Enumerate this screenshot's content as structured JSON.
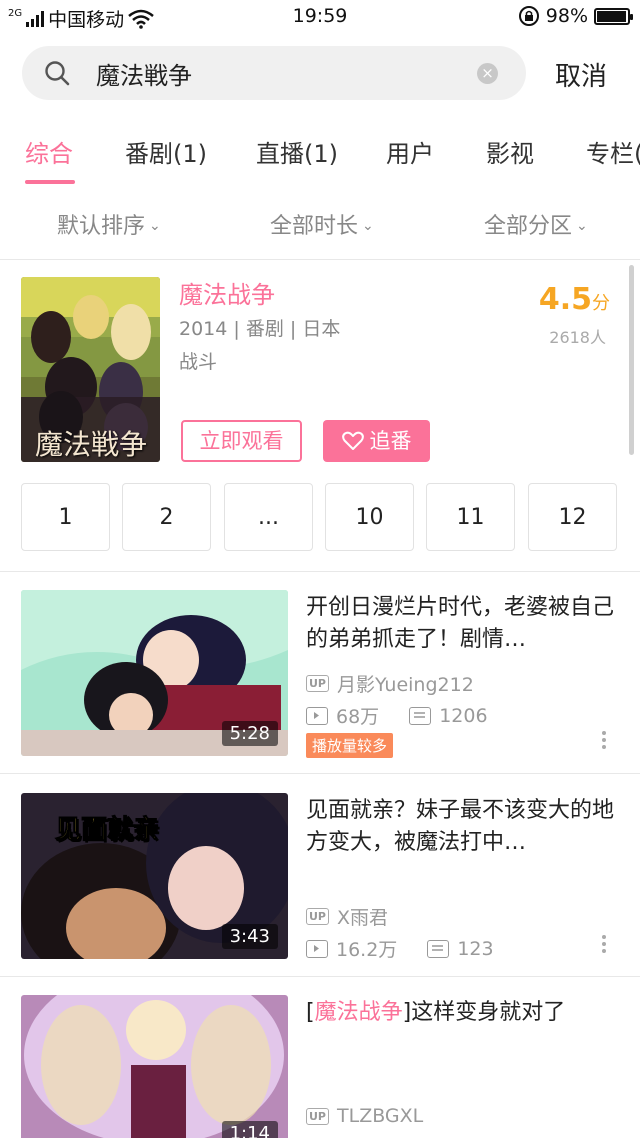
{
  "status_bar": {
    "carrier": "中国移动",
    "network": "2G",
    "time": "19:59",
    "battery": "98%",
    "battery_level": 0.98
  },
  "search": {
    "query": "魔法戦争",
    "cancel_label": "取消"
  },
  "tabs": [
    {
      "label": "综合",
      "active": true
    },
    {
      "label": "番剧(1)"
    },
    {
      "label": "直播(1)"
    },
    {
      "label": "用户"
    },
    {
      "label": "影视"
    },
    {
      "label": "专栏("
    }
  ],
  "filters": [
    {
      "label": "默认排序"
    },
    {
      "label": "全部时长"
    },
    {
      "label": "全部分区"
    }
  ],
  "anime": {
    "cover_text": "魔法戦争",
    "title": "魔法战争",
    "meta": "2014 | 番剧 | 日本",
    "genre": "战斗",
    "score": "4.5",
    "score_unit": "分",
    "votes": "2618人",
    "watch_label": "立即观看",
    "follow_label": "追番",
    "episodes": [
      "1",
      "2",
      "...",
      "10",
      "11",
      "12"
    ]
  },
  "videos": [
    {
      "title": "开创日漫烂片时代，老婆被自己的弟弟抓走了！剧情…",
      "uploader": "月影Yueing212",
      "views": "68万",
      "danmaku": "1206",
      "duration": "5:28",
      "badge": "播放量较多"
    },
    {
      "title": "见面就亲？妹子最不该变大的地方变大，被魔法打中…",
      "uploader": "X雨君",
      "views": "16.2万",
      "danmaku": "123",
      "duration": "3:43",
      "thumb_caption": "见面就亲"
    },
    {
      "title_bracket_open": "[",
      "title_highlight": "魔法战争",
      "title_rest": "]这样变身就对了",
      "uploader": "TLZBGXL",
      "duration": "1:14"
    }
  ],
  "labels": {
    "up_tag": "UP"
  },
  "colors": {
    "accent": "#fb7299",
    "score": "#f6a623",
    "badge": "#fa8a5a"
  }
}
